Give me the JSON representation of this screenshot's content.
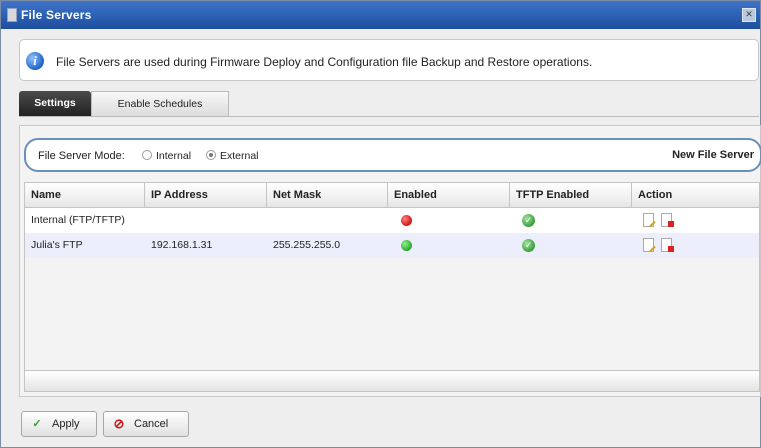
{
  "window": {
    "title": "File Servers",
    "close_glyph": "✕"
  },
  "info": {
    "icon": "info-icon",
    "message": "File Servers are used during Firmware Deploy and Configuration file Backup and Restore operations."
  },
  "tabs": [
    {
      "label": "Settings",
      "active": true
    },
    {
      "label": "Enable Schedules",
      "active": false
    }
  ],
  "mode": {
    "label": "File Server Mode:",
    "options": [
      {
        "label": "Internal",
        "selected": false
      },
      {
        "label": "External",
        "selected": true
      }
    ],
    "new_server_label": "New File Server"
  },
  "table": {
    "columns": [
      "Name",
      "IP Address",
      "Net Mask",
      "Enabled",
      "TFTP Enabled",
      "Action"
    ],
    "rows": [
      {
        "name": "Internal (FTP/TFTP)",
        "ip": "",
        "netmask": "",
        "enabled": "error-status-icon",
        "tftp_enabled": "checkmark-icon",
        "actions": [
          "edit-icon",
          "delete-icon"
        ]
      },
      {
        "name": "Julia's FTP",
        "ip": "192.168.1.31",
        "netmask": "255.255.255.0",
        "enabled": "ok-status-icon",
        "tftp_enabled": "checkmark-icon",
        "actions": [
          "edit-icon",
          "delete-icon"
        ]
      }
    ]
  },
  "buttons": {
    "apply": "Apply",
    "cancel": "Cancel"
  },
  "colors": {
    "title_bar": "#2b5fb2",
    "accent_blue": "#6a8fb8",
    "status_red": "#d21414",
    "status_green": "#2ca52c",
    "selected_row": "#eceefb"
  }
}
